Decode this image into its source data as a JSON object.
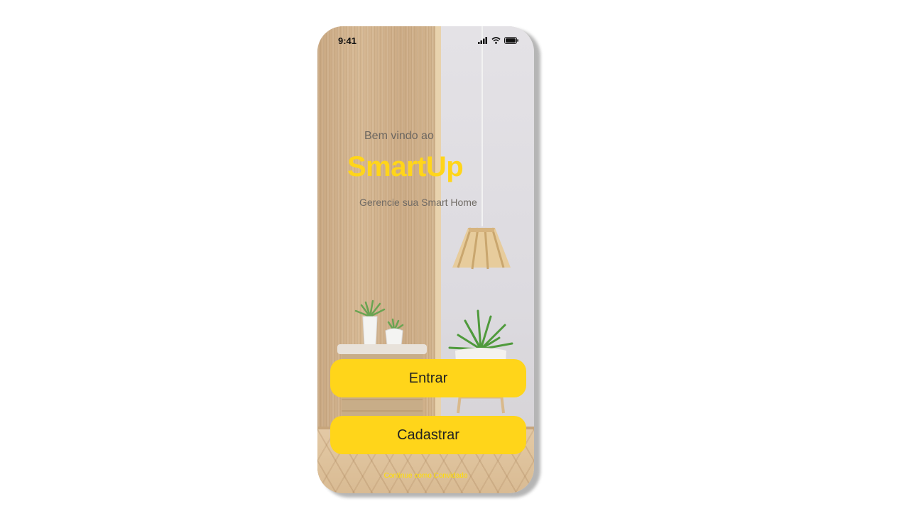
{
  "status_bar": {
    "time": "9:41",
    "icons": [
      "signal-icon",
      "wifi-icon",
      "battery-icon"
    ]
  },
  "hero": {
    "welcome": "Bem vindo ao",
    "brand": "SmartUp",
    "tagline": "Gerencie sua Smart Home"
  },
  "actions": {
    "login_label": "Entrar",
    "signup_label": "Cadastrar",
    "guest_label": "Continue como Convidado"
  },
  "colors": {
    "accent": "#ffd51a",
    "text_muted": "#6b6660",
    "guest_link": "#ffe000"
  }
}
